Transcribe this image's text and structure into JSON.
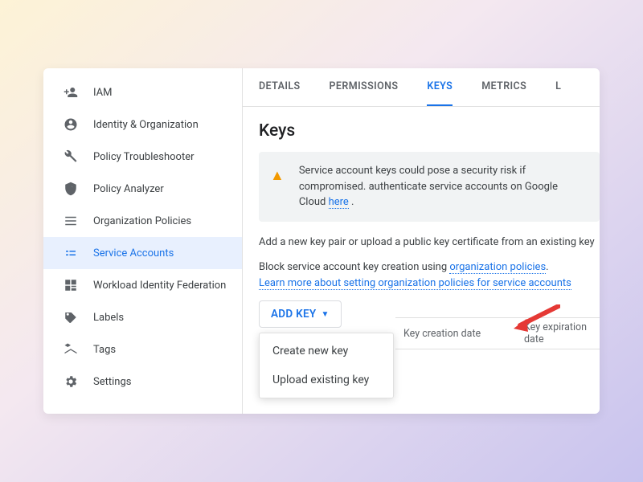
{
  "sidebar": {
    "items": [
      {
        "label": "IAM"
      },
      {
        "label": "Identity & Organization"
      },
      {
        "label": "Policy Troubleshooter"
      },
      {
        "label": "Policy Analyzer"
      },
      {
        "label": "Organization Policies"
      },
      {
        "label": "Service Accounts"
      },
      {
        "label": "Workload Identity Federation"
      },
      {
        "label": "Labels"
      },
      {
        "label": "Tags"
      },
      {
        "label": "Settings"
      }
    ]
  },
  "tabs": {
    "t0": "DETAILS",
    "t1": "PERMISSIONS",
    "t2": "KEYS",
    "t3": "METRICS",
    "t4": "L"
  },
  "keys": {
    "title": "Keys",
    "warning_text": "Service account keys could pose a security risk if compromised. authenticate service accounts on Google Cloud ",
    "warning_here": "here",
    "period": " .",
    "add_desc": "Add a new key pair or upload a public key certificate from an existing key",
    "block_line_a": "Block service account key creation using ",
    "block_policies": "organization policies",
    "block_period": ".",
    "learn_more": "Learn more about setting organization policies for service accounts",
    "add_key_label": "ADD KEY",
    "dd_create": "Create new key",
    "dd_upload": "Upload existing key",
    "col_creation": "Key creation date",
    "col_expiration": "Key expiration date"
  }
}
